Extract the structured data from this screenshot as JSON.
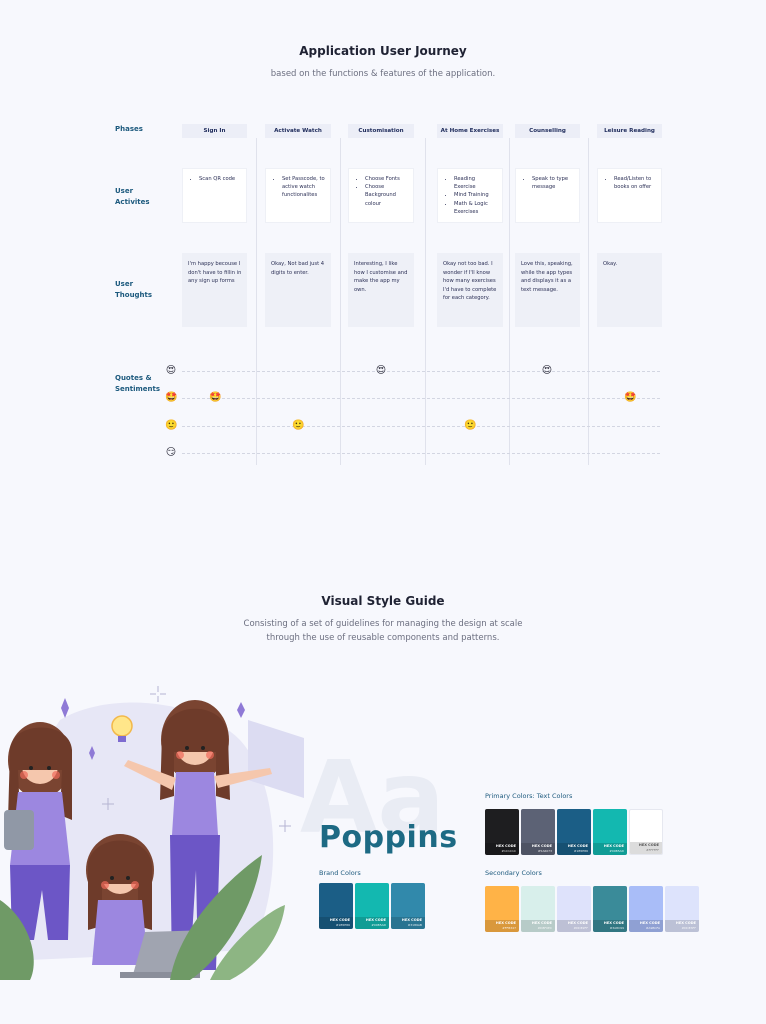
{
  "journey": {
    "title": "Application User Journey",
    "subtitle": "based on the functions & features of the application."
  },
  "rows": {
    "phases": "Phases",
    "activities": "User Activites",
    "thoughts": "User Thoughts",
    "quotes": "Quotes & Sentiments"
  },
  "phases": [
    {
      "name": "Sign In",
      "activities": [
        "Scan QR code"
      ],
      "thought": "I'm happy becouse I don't have to fillin in any sign up forms"
    },
    {
      "name": "Activate Watch",
      "activities": [
        "Set Passcode, to active watch functionalites"
      ],
      "thought": "Okay, Not bad just 4 digits to enter."
    },
    {
      "name": "Customisation",
      "activities": [
        "Choose Fonts",
        "Choose Background colour"
      ],
      "thought": "Interesting, I like how I customise and make the app my own."
    },
    {
      "name": "At Home Exercises",
      "activities": [
        "Reading Exercise",
        "Mind Training",
        "Math & Logic Exercises"
      ],
      "thought": "Okay not too bad. I wonder if I'll know how many exercises I'd have to complete for each category."
    },
    {
      "name": "Counselling",
      "activities": [
        "Speak to type message"
      ],
      "thought": "Love this, speaking, while the app types and displays it as a text message."
    },
    {
      "name": "Leisure Reading",
      "activities": [
        "Read/Listen to books on offer"
      ],
      "thought": "Okay."
    }
  ],
  "sentiments": {
    "levels": [
      "😍",
      "🤩",
      "🙂",
      "😏"
    ],
    "level_emoji": [
      "heart-eyes",
      "star-struck",
      "smile",
      "smirk"
    ],
    "per_phase_level": [
      1,
      2,
      0,
      2,
      0,
      1
    ]
  },
  "style_guide": {
    "title": "Visual Style Guide",
    "subtitle": "Consisting of a set of guidelines for managing the design at scale through the use of reusable components and patterns.",
    "font_name": "Poppins",
    "font_bg": "Aa",
    "brand_label": "Brand Colors",
    "primary_label": "Primary Colors: Text Colors",
    "secondary_label": "Secondary Colors",
    "brand_colors": [
      {
        "hex_label": "HEX CODE",
        "code": "#1B5E86",
        "color": "#1b5e86"
      },
      {
        "hex_label": "HEX CODE",
        "code": "#00B5AD",
        "color": "#13b8b0"
      },
      {
        "hex_label": "HEX CODE",
        "code": "#3189AB",
        "color": "#3189ab"
      }
    ],
    "primary_colors": [
      {
        "hex_label": "HEX CODE",
        "code": "#1C1C1C",
        "color": "#1e1e20"
      },
      {
        "hex_label": "HEX CODE",
        "code": "#5A6073",
        "color": "#5c6275"
      },
      {
        "hex_label": "HEX CODE",
        "code": "#1B5E86",
        "color": "#1b5e86"
      },
      {
        "hex_label": "HEX CODE",
        "code": "#00B5AD",
        "color": "#13b8b0"
      },
      {
        "hex_label": "HEX CODE",
        "code": "#FFFFFF",
        "color": "#ffffff"
      }
    ],
    "secondary_colors": [
      {
        "hex_label": "HEX CODE",
        "code": "#FFB347",
        "color": "#ffb347"
      },
      {
        "hex_label": "HEX CODE",
        "code": "#D8F0EC",
        "color": "#d8efeb"
      },
      {
        "hex_label": "HEX CODE",
        "code": "#DDE2FF",
        "color": "#dee2fb"
      },
      {
        "hex_label": "HEX CODE",
        "code": "#3A8C99",
        "color": "#3a8b99"
      },
      {
        "hex_label": "HEX CODE",
        "code": "#A9BCFA",
        "color": "#a9bdf8"
      },
      {
        "hex_label": "HEX CODE",
        "code": "#DDE3FF",
        "color": "#dde3fc"
      }
    ]
  }
}
